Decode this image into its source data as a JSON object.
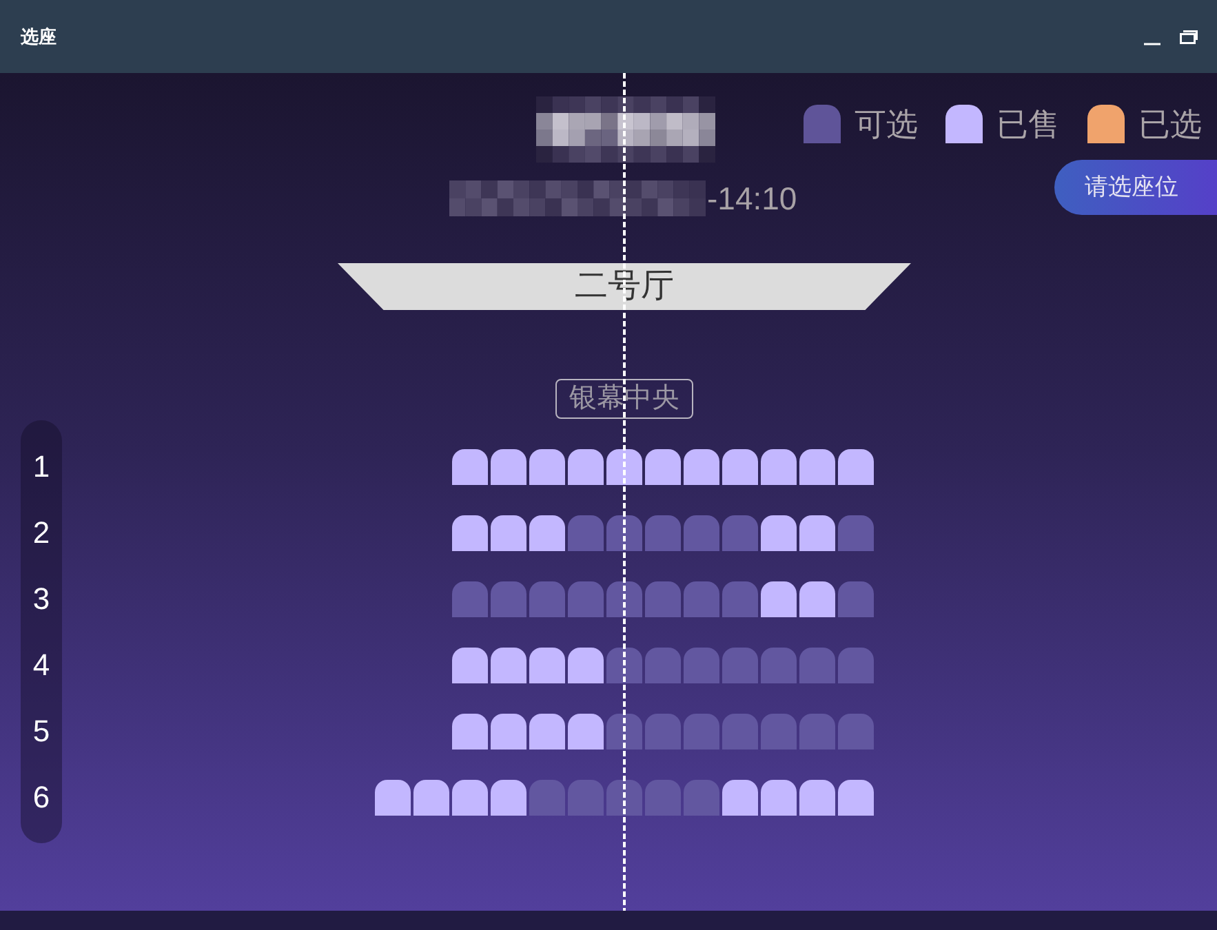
{
  "window": {
    "title": "选座"
  },
  "header": {
    "showtime": "-14:10"
  },
  "legend": [
    {
      "label": "可选",
      "color": "#5f5499"
    },
    {
      "label": "已售",
      "color": "#c3b7ff"
    },
    {
      "label": "已选",
      "color": "#f0a36c"
    }
  ],
  "action_button": {
    "label": "请选座位"
  },
  "screen": {
    "hall": "二号厅",
    "center_label": "银幕中央"
  },
  "rows": [
    {
      "label": "1",
      "seats": [
        {
          "sold": true,
          "selected": false
        },
        {
          "sold": true,
          "selected": false
        },
        {
          "sold": true,
          "selected": false
        },
        {
          "sold": true,
          "selected": false
        },
        {
          "sold": true,
          "selected": false
        },
        {
          "sold": true,
          "selected": false
        },
        {
          "sold": true,
          "selected": false
        },
        {
          "sold": true,
          "selected": false
        },
        {
          "sold": true,
          "selected": false
        },
        {
          "sold": true,
          "selected": false
        },
        {
          "sold": true,
          "selected": false
        }
      ]
    },
    {
      "label": "2",
      "seats": [
        {
          "sold": true,
          "selected": false
        },
        {
          "sold": true,
          "selected": false
        },
        {
          "sold": true,
          "selected": false
        },
        {
          "sold": false,
          "selected": false
        },
        {
          "sold": false,
          "selected": false
        },
        {
          "sold": false,
          "selected": false
        },
        {
          "sold": false,
          "selected": false
        },
        {
          "sold": false,
          "selected": false
        },
        {
          "sold": true,
          "selected": false
        },
        {
          "sold": true,
          "selected": false
        },
        {
          "sold": false,
          "selected": false
        }
      ]
    },
    {
      "label": "3",
      "seats": [
        {
          "sold": false,
          "selected": false
        },
        {
          "sold": false,
          "selected": false
        },
        {
          "sold": false,
          "selected": false
        },
        {
          "sold": false,
          "selected": false
        },
        {
          "sold": false,
          "selected": false
        },
        {
          "sold": false,
          "selected": false
        },
        {
          "sold": false,
          "selected": false
        },
        {
          "sold": false,
          "selected": false
        },
        {
          "sold": true,
          "selected": false
        },
        {
          "sold": true,
          "selected": false
        },
        {
          "sold": false,
          "selected": false
        }
      ]
    },
    {
      "label": "4",
      "seats": [
        {
          "sold": true,
          "selected": false
        },
        {
          "sold": true,
          "selected": false
        },
        {
          "sold": true,
          "selected": false
        },
        {
          "sold": true,
          "selected": false
        },
        {
          "sold": false,
          "selected": false
        },
        {
          "sold": false,
          "selected": false
        },
        {
          "sold": false,
          "selected": false
        },
        {
          "sold": false,
          "selected": false
        },
        {
          "sold": false,
          "selected": false
        },
        {
          "sold": false,
          "selected": false
        },
        {
          "sold": false,
          "selected": false
        }
      ]
    },
    {
      "label": "5",
      "seats": [
        {
          "sold": true,
          "selected": false
        },
        {
          "sold": true,
          "selected": false
        },
        {
          "sold": true,
          "selected": false
        },
        {
          "sold": true,
          "selected": false
        },
        {
          "sold": false,
          "selected": false
        },
        {
          "sold": false,
          "selected": false
        },
        {
          "sold": false,
          "selected": false
        },
        {
          "sold": false,
          "selected": false
        },
        {
          "sold": false,
          "selected": false
        },
        {
          "sold": false,
          "selected": false
        },
        {
          "sold": false,
          "selected": false
        }
      ]
    },
    {
      "label": "6",
      "seats": [
        {
          "sold": true,
          "selected": false
        },
        {
          "sold": true,
          "selected": false
        },
        {
          "sold": true,
          "selected": false
        },
        {
          "sold": true,
          "selected": false
        },
        {
          "sold": false,
          "selected": false
        },
        {
          "sold": false,
          "selected": false
        },
        {
          "sold": false,
          "selected": false
        },
        {
          "sold": false,
          "selected": false
        },
        {
          "sold": false,
          "selected": false
        },
        {
          "sold": true,
          "selected": false
        },
        {
          "sold": true,
          "selected": false
        },
        {
          "sold": true,
          "selected": false
        },
        {
          "sold": true,
          "selected": false
        }
      ]
    }
  ]
}
